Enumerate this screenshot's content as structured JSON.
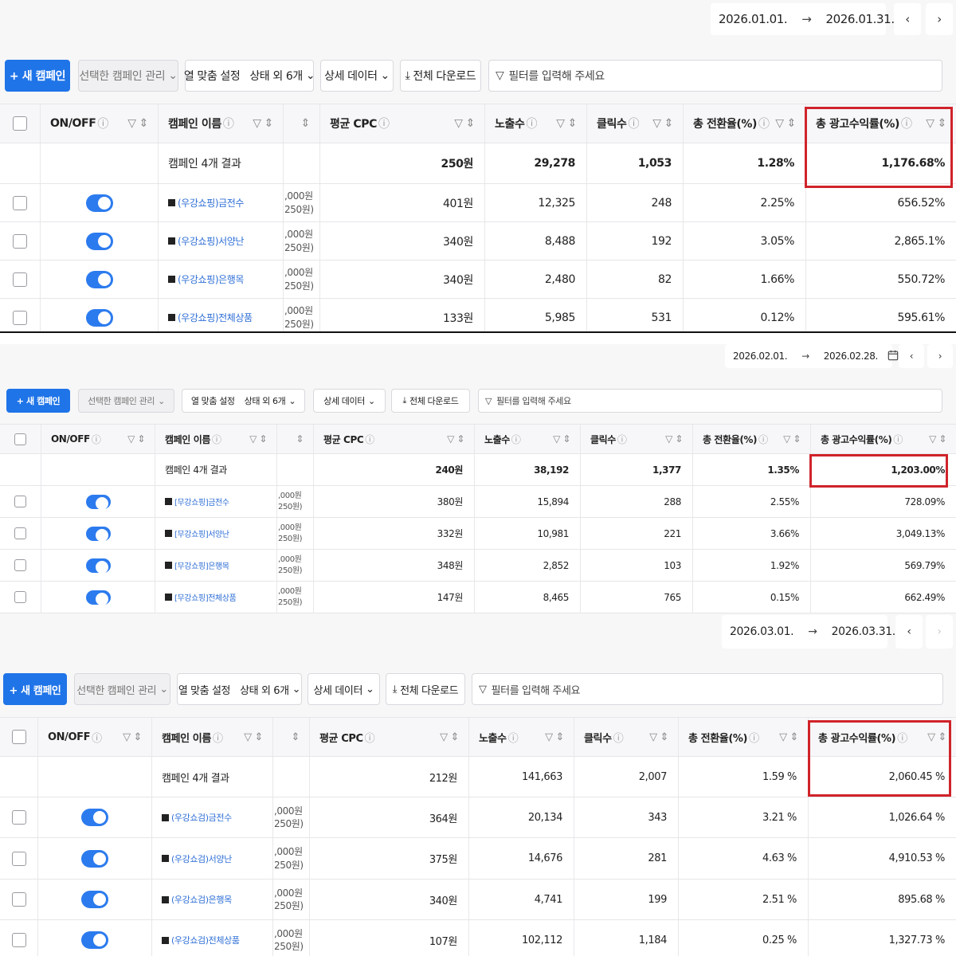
{
  "labels": {
    "new_campaign": "+ 새 캠페인",
    "manage_selected": "선택한 캠페인 관리",
    "column_settings": "열 맞춤 설정",
    "status_etc": "상태 외 6개",
    "detail_data": "상세 데이터",
    "download_all": "전체 다운로드",
    "filter_placeholder": "필터를 입력해 주세요"
  },
  "columns": {
    "onoff": "ON/OFF",
    "name": "캠페인 이름",
    "cpc": "평균 CPC",
    "impressions": "노출수",
    "clicks": "클릭수",
    "conv_rate": "총 전환율(%)",
    "roas": "총 광고수익률(%)"
  },
  "panels": [
    {
      "date_start": "2026.01.01.",
      "date_end": "2026.01.31.",
      "summary": {
        "label": "캠페인 4개 결과",
        "cpc": "250원",
        "impressions": "29,278",
        "clicks": "1,053",
        "conv_rate": "1.28%",
        "roas": "1,176.68%"
      },
      "rows": [
        {
          "name": "(우강쇼핑)금전수",
          "budget1": ",000원",
          "budget2": "250원)",
          "cpc": "401원",
          "impressions": "12,325",
          "clicks": "248",
          "conv_rate": "2.25%",
          "roas": "656.52%"
        },
        {
          "name": "(우강쇼핑)서양난",
          "budget1": ",000원",
          "budget2": "250원)",
          "cpc": "340원",
          "impressions": "8,488",
          "clicks": "192",
          "conv_rate": "3.05%",
          "roas": "2,865.1%"
        },
        {
          "name": "(우강쇼핑)은행목",
          "budget1": ",000원",
          "budget2": "250원)",
          "cpc": "340원",
          "impressions": "2,480",
          "clicks": "82",
          "conv_rate": "1.66%",
          "roas": "550.72%"
        },
        {
          "name": "(우강쇼핑)전체상품",
          "budget1": ",000원",
          "budget2": "250원)",
          "cpc": "133원",
          "impressions": "5,985",
          "clicks": "531",
          "conv_rate": "0.12%",
          "roas": "595.61%"
        }
      ]
    },
    {
      "date_start": "2026.02.01.",
      "date_end": "2026.02.28.",
      "summary": {
        "label": "캠페인 4개 결과",
        "cpc": "240원",
        "impressions": "38,192",
        "clicks": "1,377",
        "conv_rate": "1.35%",
        "roas": "1,203.00%"
      },
      "rows": [
        {
          "name": "[무강쇼핑]금전수",
          "budget1": ",000원",
          "budget2": "250원)",
          "cpc": "380원",
          "impressions": "15,894",
          "clicks": "288",
          "conv_rate": "2.55%",
          "roas": "728.09%"
        },
        {
          "name": "[무강쇼핑]서양난",
          "budget1": ",000원",
          "budget2": "250원)",
          "cpc": "332원",
          "impressions": "10,981",
          "clicks": "221",
          "conv_rate": "3.66%",
          "roas": "3,049.13%"
        },
        {
          "name": "[무강쇼핑]은행목",
          "budget1": ",000원",
          "budget2": "250원)",
          "cpc": "348원",
          "impressions": "2,852",
          "clicks": "103",
          "conv_rate": "1.92%",
          "roas": "569.79%"
        },
        {
          "name": "[무강쇼핑]전체상품",
          "budget1": ",000원",
          "budget2": "250원)",
          "cpc": "147원",
          "impressions": "8,465",
          "clicks": "765",
          "conv_rate": "0.15%",
          "roas": "662.49%"
        }
      ]
    },
    {
      "date_start": "2026.03.01.",
      "date_end": "2026.03.31.",
      "summary": {
        "label": "캠페인 4개 결과",
        "cpc": "212원",
        "impressions": "141,663",
        "clicks": "2,007",
        "conv_rate": "1.59 %",
        "roas": "2,060.45 %"
      },
      "rows": [
        {
          "name": "(우강쇼검)금전수",
          "budget1": ",000원",
          "budget2": "250원)",
          "cpc": "364원",
          "impressions": "20,134",
          "clicks": "343",
          "conv_rate": "3.21 %",
          "roas": "1,026.64 %"
        },
        {
          "name": "(우강쇼검)서양난",
          "budget1": ",000원",
          "budget2": "250원)",
          "cpc": "375원",
          "impressions": "14,676",
          "clicks": "281",
          "conv_rate": "4.63 %",
          "roas": "4,910.53 %"
        },
        {
          "name": "(우강쇼검)은행목",
          "budget1": ",000원",
          "budget2": "250원)",
          "cpc": "340원",
          "impressions": "4,741",
          "clicks": "199",
          "conv_rate": "2.51 %",
          "roas": "895.68 %"
        },
        {
          "name": "(우강쇼검)전체상품",
          "budget1": ",000원",
          "budget2": "250원)",
          "cpc": "107원",
          "impressions": "102,112",
          "clicks": "1,184",
          "conv_rate": "0.25 %",
          "roas": "1,327.73 %"
        }
      ]
    }
  ]
}
